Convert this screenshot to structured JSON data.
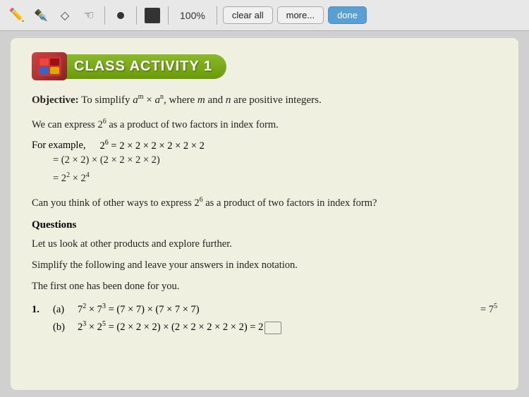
{
  "toolbar": {
    "zoom": "100%",
    "clear_all": "clear all",
    "more": "more...",
    "done": "done"
  },
  "activity": {
    "title": "CLASS ACTIVITY 1",
    "objective_label": "Objective:",
    "objective_text": "To simplify a",
    "objective_exp1": "m",
    "objective_mid": " × a",
    "objective_exp2": "n",
    "objective_end": ", where ",
    "objective_m": "m",
    "objective_and": " and ",
    "objective_n": "n",
    "objective_rest": " are positive integers.",
    "para1": "We can express 2",
    "para1_exp": "6",
    "para1_rest": " as a product of two factors in index form.",
    "example_label": "For example,",
    "math_line1": "2⁶ = 2 × 2 × 2 × 2 × 2 × 2",
    "math_line2": "= (2 × 2) × (2 × 2 × 2 × 2)",
    "math_line3_a": "= 2",
    "math_line3_exp1": "2",
    "math_line3_b": " × 2",
    "math_line3_exp2": "4",
    "question_para1": "Can you think of other ways to express 2",
    "question_exp": "6",
    "question_rest": " as a product of two factors in index form?",
    "questions_heading": "Questions",
    "q_intro1": "Let us look at other products and explore further.",
    "q_intro2": "Simplify the following and leave your answers in index notation.",
    "q_intro3": "The first one has been done for you.",
    "q1_num": "1.",
    "q1a_part": "(a)",
    "q1a_content_a": "7",
    "q1a_exp1": "2",
    "q1a_mid": " × 7",
    "q1a_exp2": "3",
    "q1a_eq": " = (7 × 7) × (7 × 7 × 7)",
    "q1a_ans_a": "= 7",
    "q1a_ans_exp": "5",
    "q1b_part": "(b)",
    "q1b_content_a": "2",
    "q1b_exp1": "3",
    "q1b_mid": " × 2",
    "q1b_exp2": "5",
    "q1b_eq": " = (2 × 2 × 2) × (2 × 2 × 2 × 2 × 2) = 2"
  }
}
